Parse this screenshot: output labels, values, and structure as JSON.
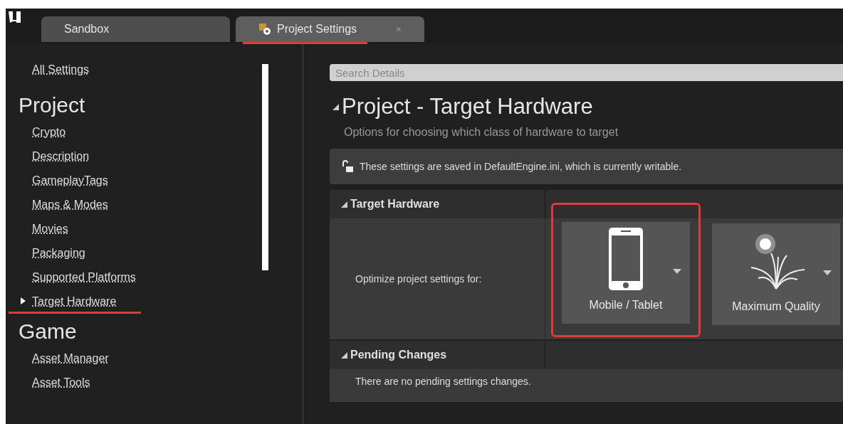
{
  "tabs": [
    {
      "label": "Sandbox",
      "selected": false,
      "highlighted": false
    },
    {
      "label": "Project Settings",
      "selected": true,
      "highlighted": true,
      "close": "×"
    }
  ],
  "sidebar": {
    "top_link": "All Settings",
    "groups": [
      {
        "title": "Project",
        "items": [
          {
            "label": "Crypto",
            "selected": false,
            "highlighted": false
          },
          {
            "label": "Description",
            "selected": false,
            "highlighted": false
          },
          {
            "label": "GameplayTags",
            "selected": false,
            "highlighted": false
          },
          {
            "label": "Maps & Modes",
            "selected": false,
            "highlighted": false
          },
          {
            "label": "Movies",
            "selected": false,
            "highlighted": false
          },
          {
            "label": "Packaging",
            "selected": false,
            "highlighted": false
          },
          {
            "label": "Supported Platforms",
            "selected": false,
            "highlighted": false
          },
          {
            "label": "Target Hardware",
            "selected": true,
            "highlighted": true
          }
        ]
      },
      {
        "title": "Game",
        "items": [
          {
            "label": "Asset Manager",
            "selected": false,
            "highlighted": false
          },
          {
            "label": "Asset Tools",
            "selected": false,
            "highlighted": false
          }
        ]
      }
    ]
  },
  "search": {
    "placeholder": "Search Details"
  },
  "page": {
    "title": "Project - Target Hardware",
    "subtitle": "Options for choosing which class of hardware to target",
    "info": "These settings are saved in DefaultEngine.ini, which is currently writable."
  },
  "sections": [
    {
      "title": "Target Hardware",
      "kind": "options",
      "label": "Optimize project settings for:",
      "options": [
        {
          "label": "Mobile / Tablet",
          "kind": "phone",
          "highlighted": true
        },
        {
          "label": "Maximum Quality",
          "kind": "quality",
          "highlighted": false
        }
      ]
    },
    {
      "title": "Pending Changes",
      "kind": "text",
      "text": "There are no pending settings changes."
    }
  ]
}
